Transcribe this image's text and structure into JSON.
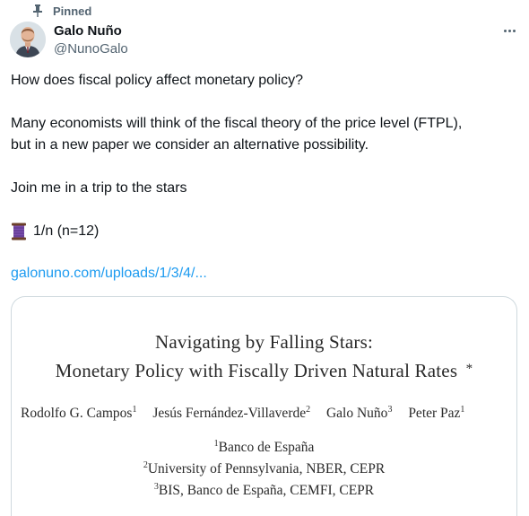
{
  "pinned_label": "Pinned",
  "author": {
    "name": "Galo Nuño",
    "handle": "@NunoGalo"
  },
  "tweet": {
    "line1": "How does fiscal policy affect monetary policy?",
    "line2": "Many economists will think of the fiscal theory of the price level (FTPL),",
    "line3": "but in a new paper we consider an alternative  possibility.",
    "line4": "Join me in a trip to the stars",
    "thread_text": "1/n (n=12)",
    "link": "galonuno.com/uploads/1/3/4/..."
  },
  "paper": {
    "title_line1": "Navigating by Falling Stars:",
    "title_line2": "Monetary Policy with Fiscally Driven Natural Rates",
    "title_mark": "*",
    "authors": [
      {
        "name": "Rodolfo G. Campos",
        "sup": "1"
      },
      {
        "name": "Jesús Fernández-Villaverde",
        "sup": "2"
      },
      {
        "name": "Galo Nuño",
        "sup": "3"
      },
      {
        "name": "Peter Paz",
        "sup": "1"
      }
    ],
    "affiliations": [
      {
        "sup": "1",
        "text": "Banco de España"
      },
      {
        "sup": "2",
        "text": "University of Pennsylvania, NBER, CEPR"
      },
      {
        "sup": "3",
        "text": "BIS, Banco de España, CEMFI, CEPR"
      }
    ]
  },
  "icons": {
    "pin": "pin-icon",
    "more": "more-icon",
    "thread": "spool-of-thread-icon"
  },
  "colors": {
    "text": "#0f1419",
    "secondary": "#536471",
    "link": "#1d9bf0",
    "border": "#cfd9de"
  }
}
